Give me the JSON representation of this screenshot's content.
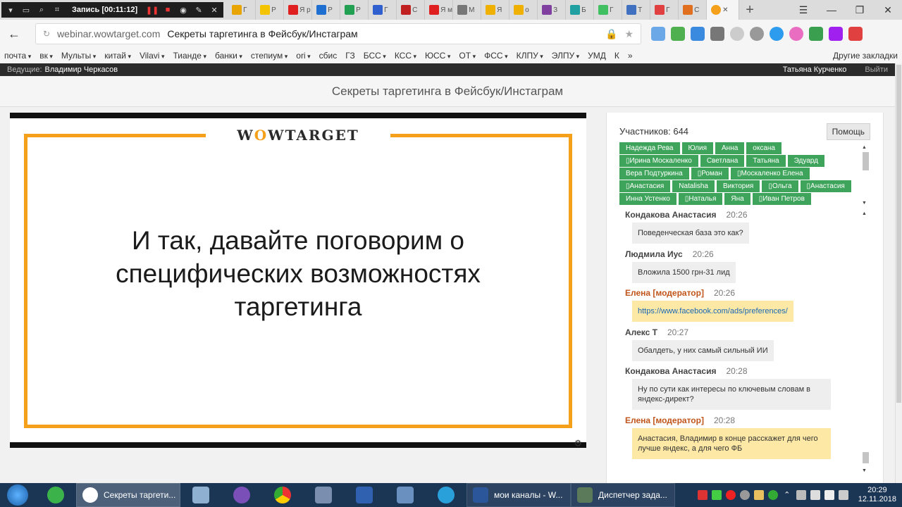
{
  "browser": {
    "recorder": {
      "title": "Запись [00:11:12]"
    },
    "tabs": [
      {
        "label": "Г",
        "color": "#e8a400"
      },
      {
        "label": "Р",
        "color": "#f4c400"
      },
      {
        "label": "Я р",
        "color": "#e02020"
      },
      {
        "label": "Р",
        "color": "#1e6fd0"
      },
      {
        "label": "Р",
        "color": "#20a050"
      },
      {
        "label": "Г",
        "color": "#3060d0"
      },
      {
        "label": "С",
        "color": "#c02020"
      },
      {
        "label": "Я м",
        "color": "#e02020"
      },
      {
        "label": "М",
        "color": "#777777"
      },
      {
        "label": "Я",
        "color": "#f0b000"
      },
      {
        "label": "о",
        "color": "#f0b000"
      },
      {
        "label": "З",
        "color": "#8040a0"
      },
      {
        "label": "Б",
        "color": "#20a0a0"
      },
      {
        "label": "Г",
        "color": "#40c060"
      },
      {
        "label": "Т",
        "color": "#4070c0"
      },
      {
        "label": "Г",
        "color": "#e04040"
      },
      {
        "label": "С",
        "color": "#e07020"
      }
    ],
    "address": {
      "domain": "webinar.wowtarget.com",
      "title": "Секреты таргетинга в Фейсбук/Инстаграм"
    },
    "bookmarks": [
      {
        "label": "почта",
        "folder": true
      },
      {
        "label": "вк",
        "folder": true
      },
      {
        "label": "Мульты",
        "folder": true
      },
      {
        "label": "китай",
        "folder": true
      },
      {
        "label": "Vilavi",
        "folder": true
      },
      {
        "label": "Тианде",
        "folder": true
      },
      {
        "label": "банки",
        "folder": true
      },
      {
        "label": "степиум",
        "folder": true
      },
      {
        "label": "ori",
        "folder": true
      },
      {
        "label": "сбис",
        "folder": false
      },
      {
        "label": "ГЗ",
        "folder": false
      },
      {
        "label": "БСС",
        "folder": true
      },
      {
        "label": "КСС",
        "folder": true
      },
      {
        "label": "ЮСС",
        "folder": true
      },
      {
        "label": "ОТ",
        "folder": true
      },
      {
        "label": "ФСС",
        "folder": true
      },
      {
        "label": "КЛПУ",
        "folder": true
      },
      {
        "label": "ЭЛПУ",
        "folder": true
      },
      {
        "label": "УМД",
        "folder": false
      },
      {
        "label": "К",
        "folder": false
      },
      {
        "label": "»",
        "folder": false
      }
    ],
    "other_bookmarks": "Другие закладки"
  },
  "webinar": {
    "host_label": "Ведущие:",
    "host_name": "Владимир Черкасов",
    "user_name": "Татьяна Курченко",
    "logout": "Выйти",
    "header_title": "Секреты таргетинга в Фейсбук/Инстаграм",
    "slide": {
      "logo_pre": "W",
      "logo_o": "O",
      "logo_post": "WTARGET",
      "line1": "И так, давайте поговорим о",
      "line2": "специфических возможностях",
      "line3": "таргетинга"
    },
    "panel": {
      "participants": "Участников: 644",
      "help": "Помощь",
      "tags": [
        "Надежда Рева",
        "Юлия",
        "Анна",
        "оксана",
        "▯Ирина Москаленко",
        "Светлана",
        "Татьяна",
        "Эдуард",
        "Вера Подтуркина",
        "▯Роман",
        "▯Москаленко Елена",
        "▯Анастасия",
        "Natalisha",
        "Виктория",
        "▯Ольга",
        "▯Анастасия",
        "Инна Устенко",
        "▯Наталья",
        "Яна",
        "▯Иван Петров"
      ],
      "messages": [
        {
          "author": "Кондакова Анастасия",
          "time": "20:26",
          "text": "Поведенческая база это как?",
          "moderator": false
        },
        {
          "author": "Людмила Иус",
          "time": "20:26",
          "text": "Вложила 1500 грн-31 лид",
          "moderator": false
        },
        {
          "author": "Елена [модератор]",
          "time": "20:26",
          "text": "https://www.facebook.com/ads/preferences/",
          "moderator": true
        },
        {
          "author": "Алекс Т",
          "time": "20:27",
          "text": "Обалдеть, у них самый сильный ИИ",
          "moderator": false
        },
        {
          "author": "Кондакова Анастасия",
          "time": "20:28",
          "text": "Ну по сути как интересы по ключевым словам в яндекс-директ?",
          "moderator": false
        },
        {
          "author": "Елена [модератор]",
          "time": "20:28",
          "text": "Анастасия, Владимир в конце расскажет для чего лучше яндекс, а для чего ФБ",
          "moderator": true
        }
      ]
    }
  },
  "taskbar": {
    "items": [
      {
        "label": "Секреты таргети...",
        "active": true
      },
      {
        "label": "мои каналы - W...",
        "active": false
      },
      {
        "label": "Диспетчер зада...",
        "active": false
      }
    ],
    "time": "20:29",
    "date": "12.11.2018"
  },
  "colors": {
    "accent_orange": "#f5a01a",
    "tag_green": "#3fa45b",
    "moderator_text": "#c0541a",
    "moderator_bubble": "#fde9a5"
  }
}
